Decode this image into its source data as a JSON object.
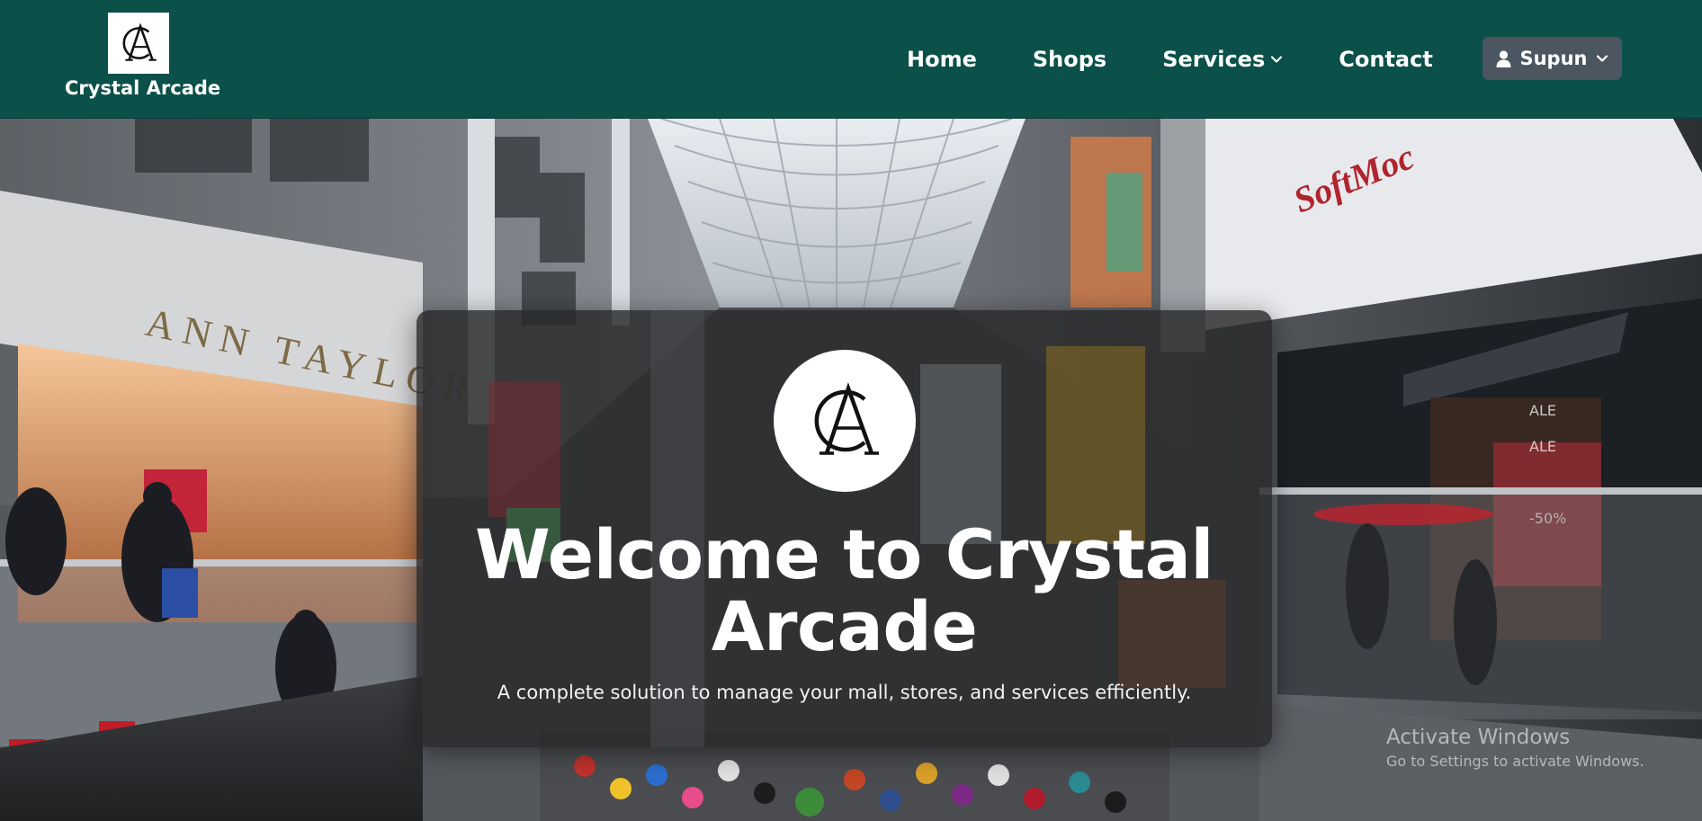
{
  "brand": {
    "name": "Crystal Arcade",
    "logo_text": "CA",
    "color": "#0b5049"
  },
  "nav": {
    "items": [
      {
        "label": "Home"
      },
      {
        "label": "Shops"
      },
      {
        "label": "Services",
        "has_dropdown": true
      },
      {
        "label": "Contact"
      }
    ],
    "user": {
      "label": "Supun",
      "icon": "person-icon",
      "button_color": "#4b5661"
    }
  },
  "hero": {
    "background": "mall-interior-photo",
    "storefront_signs": [
      "ANN TAYLOR",
      "SoftMoc"
    ],
    "card": {
      "title": "Welcome to Crystal Arcade",
      "subtitle": "A complete solution to manage your mall, stores, and services efficiently."
    }
  },
  "watermark": {
    "title": "Activate Windows",
    "subtitle": "Go to Settings to activate Windows."
  }
}
